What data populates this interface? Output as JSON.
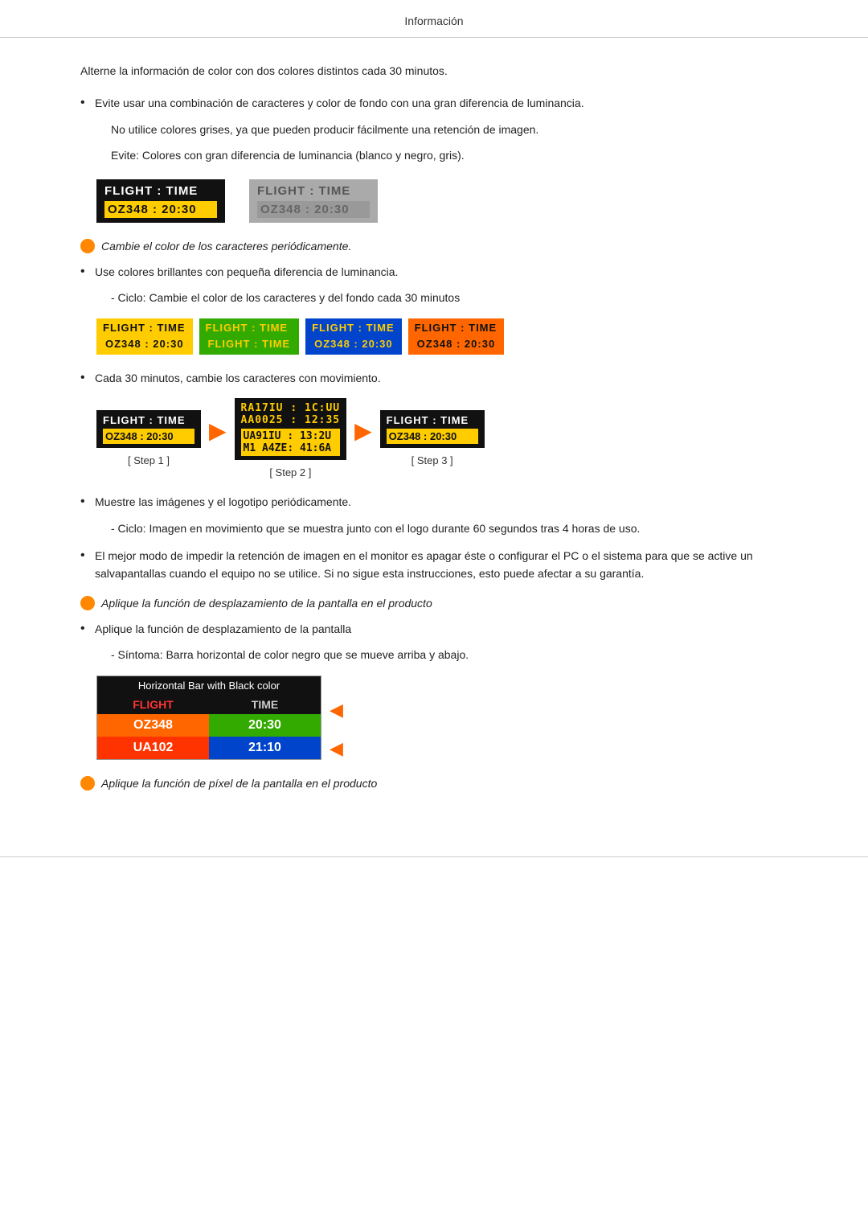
{
  "header": {
    "title": "Información"
  },
  "content": {
    "intro": "Alterne la información de color con dos colores distintos cada 30 minutos.",
    "bullet1": {
      "dot": "•",
      "text": "Evite usar una combinación de caracteres y color de fondo con una gran diferencia de luminancia."
    },
    "sub1": "No utilice colores grises, ya que pueden producir fácilmente una retención de imagen.",
    "sub2": "Evite: Colores con gran diferencia de luminancia (blanco y negro, gris).",
    "orange1": {
      "text": "Cambie el color de los caracteres periódicamente."
    },
    "bullet2": {
      "dot": "•",
      "text": "Use colores brillantes con pequeña diferencia de luminancia."
    },
    "sub3": "- Ciclo: Cambie el color de los caracteres y del fondo cada 30 minutos",
    "bullet3": {
      "dot": "•",
      "text": "Cada 30 minutos, cambie los caracteres con movimiento."
    },
    "bullet4": {
      "dot": "•",
      "text": "Muestre las imágenes y el logotipo periódicamente."
    },
    "sub4": "- Ciclo: Imagen en movimiento que se muestra junto con el logo durante 60 segundos tras 4 horas de uso.",
    "bullet5": {
      "dot": "•",
      "text": "El mejor modo de impedir la retención de imagen en el monitor es apagar éste o configurar el PC o el sistema para que se active un salvapantallas cuando el equipo no se utilice. Si no sigue esta instrucciones, esto puede afectar a su garantía."
    },
    "orange2": {
      "text": "Aplique la función de desplazamiento de la pantalla en el producto"
    },
    "bullet6": {
      "dot": "•",
      "text": "Aplique la función de desplazamiento de la pantalla"
    },
    "sub5": "- Síntoma: Barra horizontal de color negro que se mueve arriba y abajo.",
    "orange3": {
      "text": "Aplique la función de píxel de la pantalla en el producto"
    }
  },
  "flight_box_dark": {
    "row1": "FLIGHT  :  TIME",
    "row2": "OZ348   :  20:30"
  },
  "flight_box_gray": {
    "row1": "FLIGHT  :  TIME",
    "row2": "OZ348   :  20:30"
  },
  "cycle_boxes": [
    {
      "id": "cb1",
      "row1": "FLIGHT : TIME",
      "row2": "OZ348  : 20:30",
      "bg": "#ffcc00",
      "textColor": "#111",
      "row2bg": "#ffcc00"
    },
    {
      "id": "cb2",
      "row1": "FLIGHT : TIME",
      "row2": "FLIGHT : TIME",
      "bg": "#33aa00",
      "textColor": "#ffcc00",
      "row2bg": "#33aa00"
    },
    {
      "id": "cb3",
      "row1": "FLIGHT : TIME",
      "row2": "OZ348  : 20:30",
      "bg": "#0044cc",
      "textColor": "#ffcc00",
      "row2bg": "#0044cc"
    },
    {
      "id": "cb4",
      "row1": "FLIGHT : TIME",
      "row2": "OZ348  : 20:30",
      "bg": "#ff6600",
      "textColor": "#111",
      "row2bg": "#ff6600"
    }
  ],
  "steps": {
    "step1": {
      "row1": "FLIGHT : TIME",
      "row2": "OZ348  : 20:30",
      "label": "[ Step 1 ]"
    },
    "step2": {
      "row1": "RA17IU : 1C:UU\nAA0025 : 12:35",
      "row2": "UA91IU : 13:2U\nM1 A4ZE : 41:6A",
      "label": "[ Step 2 ]"
    },
    "step3": {
      "row1": "FLIGHT : TIME",
      "row2": "OZ348  : 20:30",
      "label": "[ Step 3 ]"
    }
  },
  "hbar": {
    "title": "Horizontal Bar with Black color",
    "header_flight": "FLIGHT",
    "header_time": "TIME",
    "row1_left": "OZ348",
    "row1_right": "20:30",
    "row2_left": "UA102",
    "row2_right": "21:10"
  }
}
